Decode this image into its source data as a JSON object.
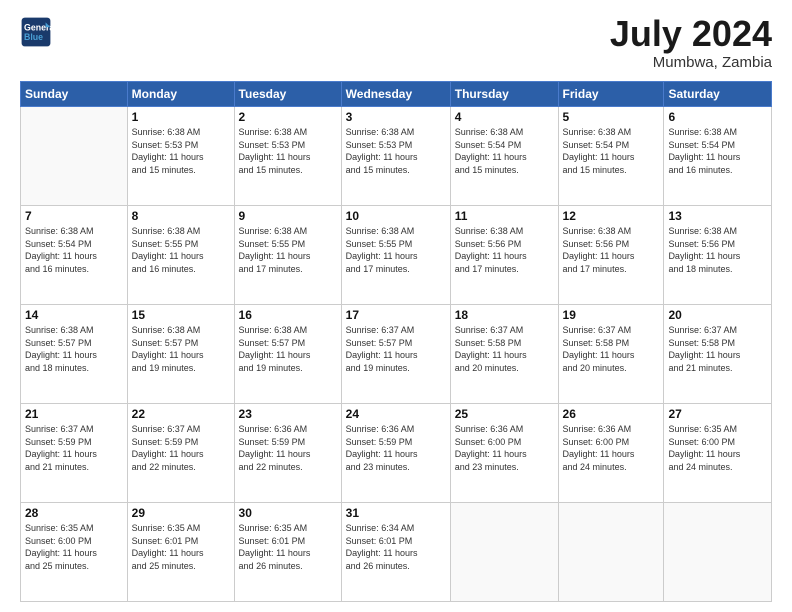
{
  "header": {
    "logo_line1": "General",
    "logo_line2": "Blue",
    "title": "July 2024",
    "subtitle": "Mumbwa, Zambia"
  },
  "weekdays": [
    "Sunday",
    "Monday",
    "Tuesday",
    "Wednesday",
    "Thursday",
    "Friday",
    "Saturday"
  ],
  "weeks": [
    [
      {
        "day": "",
        "info": ""
      },
      {
        "day": "1",
        "info": "Sunrise: 6:38 AM\nSunset: 5:53 PM\nDaylight: 11 hours\nand 15 minutes."
      },
      {
        "day": "2",
        "info": "Sunrise: 6:38 AM\nSunset: 5:53 PM\nDaylight: 11 hours\nand 15 minutes."
      },
      {
        "day": "3",
        "info": "Sunrise: 6:38 AM\nSunset: 5:53 PM\nDaylight: 11 hours\nand 15 minutes."
      },
      {
        "day": "4",
        "info": "Sunrise: 6:38 AM\nSunset: 5:54 PM\nDaylight: 11 hours\nand 15 minutes."
      },
      {
        "day": "5",
        "info": "Sunrise: 6:38 AM\nSunset: 5:54 PM\nDaylight: 11 hours\nand 15 minutes."
      },
      {
        "day": "6",
        "info": "Sunrise: 6:38 AM\nSunset: 5:54 PM\nDaylight: 11 hours\nand 16 minutes."
      }
    ],
    [
      {
        "day": "7",
        "info": "Sunrise: 6:38 AM\nSunset: 5:54 PM\nDaylight: 11 hours\nand 16 minutes."
      },
      {
        "day": "8",
        "info": "Sunrise: 6:38 AM\nSunset: 5:55 PM\nDaylight: 11 hours\nand 16 minutes."
      },
      {
        "day": "9",
        "info": "Sunrise: 6:38 AM\nSunset: 5:55 PM\nDaylight: 11 hours\nand 17 minutes."
      },
      {
        "day": "10",
        "info": "Sunrise: 6:38 AM\nSunset: 5:55 PM\nDaylight: 11 hours\nand 17 minutes."
      },
      {
        "day": "11",
        "info": "Sunrise: 6:38 AM\nSunset: 5:56 PM\nDaylight: 11 hours\nand 17 minutes."
      },
      {
        "day": "12",
        "info": "Sunrise: 6:38 AM\nSunset: 5:56 PM\nDaylight: 11 hours\nand 17 minutes."
      },
      {
        "day": "13",
        "info": "Sunrise: 6:38 AM\nSunset: 5:56 PM\nDaylight: 11 hours\nand 18 minutes."
      }
    ],
    [
      {
        "day": "14",
        "info": "Sunrise: 6:38 AM\nSunset: 5:57 PM\nDaylight: 11 hours\nand 18 minutes."
      },
      {
        "day": "15",
        "info": "Sunrise: 6:38 AM\nSunset: 5:57 PM\nDaylight: 11 hours\nand 19 minutes."
      },
      {
        "day": "16",
        "info": "Sunrise: 6:38 AM\nSunset: 5:57 PM\nDaylight: 11 hours\nand 19 minutes."
      },
      {
        "day": "17",
        "info": "Sunrise: 6:37 AM\nSunset: 5:57 PM\nDaylight: 11 hours\nand 19 minutes."
      },
      {
        "day": "18",
        "info": "Sunrise: 6:37 AM\nSunset: 5:58 PM\nDaylight: 11 hours\nand 20 minutes."
      },
      {
        "day": "19",
        "info": "Sunrise: 6:37 AM\nSunset: 5:58 PM\nDaylight: 11 hours\nand 20 minutes."
      },
      {
        "day": "20",
        "info": "Sunrise: 6:37 AM\nSunset: 5:58 PM\nDaylight: 11 hours\nand 21 minutes."
      }
    ],
    [
      {
        "day": "21",
        "info": "Sunrise: 6:37 AM\nSunset: 5:59 PM\nDaylight: 11 hours\nand 21 minutes."
      },
      {
        "day": "22",
        "info": "Sunrise: 6:37 AM\nSunset: 5:59 PM\nDaylight: 11 hours\nand 22 minutes."
      },
      {
        "day": "23",
        "info": "Sunrise: 6:36 AM\nSunset: 5:59 PM\nDaylight: 11 hours\nand 22 minutes."
      },
      {
        "day": "24",
        "info": "Sunrise: 6:36 AM\nSunset: 5:59 PM\nDaylight: 11 hours\nand 23 minutes."
      },
      {
        "day": "25",
        "info": "Sunrise: 6:36 AM\nSunset: 6:00 PM\nDaylight: 11 hours\nand 23 minutes."
      },
      {
        "day": "26",
        "info": "Sunrise: 6:36 AM\nSunset: 6:00 PM\nDaylight: 11 hours\nand 24 minutes."
      },
      {
        "day": "27",
        "info": "Sunrise: 6:35 AM\nSunset: 6:00 PM\nDaylight: 11 hours\nand 24 minutes."
      }
    ],
    [
      {
        "day": "28",
        "info": "Sunrise: 6:35 AM\nSunset: 6:00 PM\nDaylight: 11 hours\nand 25 minutes."
      },
      {
        "day": "29",
        "info": "Sunrise: 6:35 AM\nSunset: 6:01 PM\nDaylight: 11 hours\nand 25 minutes."
      },
      {
        "day": "30",
        "info": "Sunrise: 6:35 AM\nSunset: 6:01 PM\nDaylight: 11 hours\nand 26 minutes."
      },
      {
        "day": "31",
        "info": "Sunrise: 6:34 AM\nSunset: 6:01 PM\nDaylight: 11 hours\nand 26 minutes."
      },
      {
        "day": "",
        "info": ""
      },
      {
        "day": "",
        "info": ""
      },
      {
        "day": "",
        "info": ""
      }
    ]
  ]
}
